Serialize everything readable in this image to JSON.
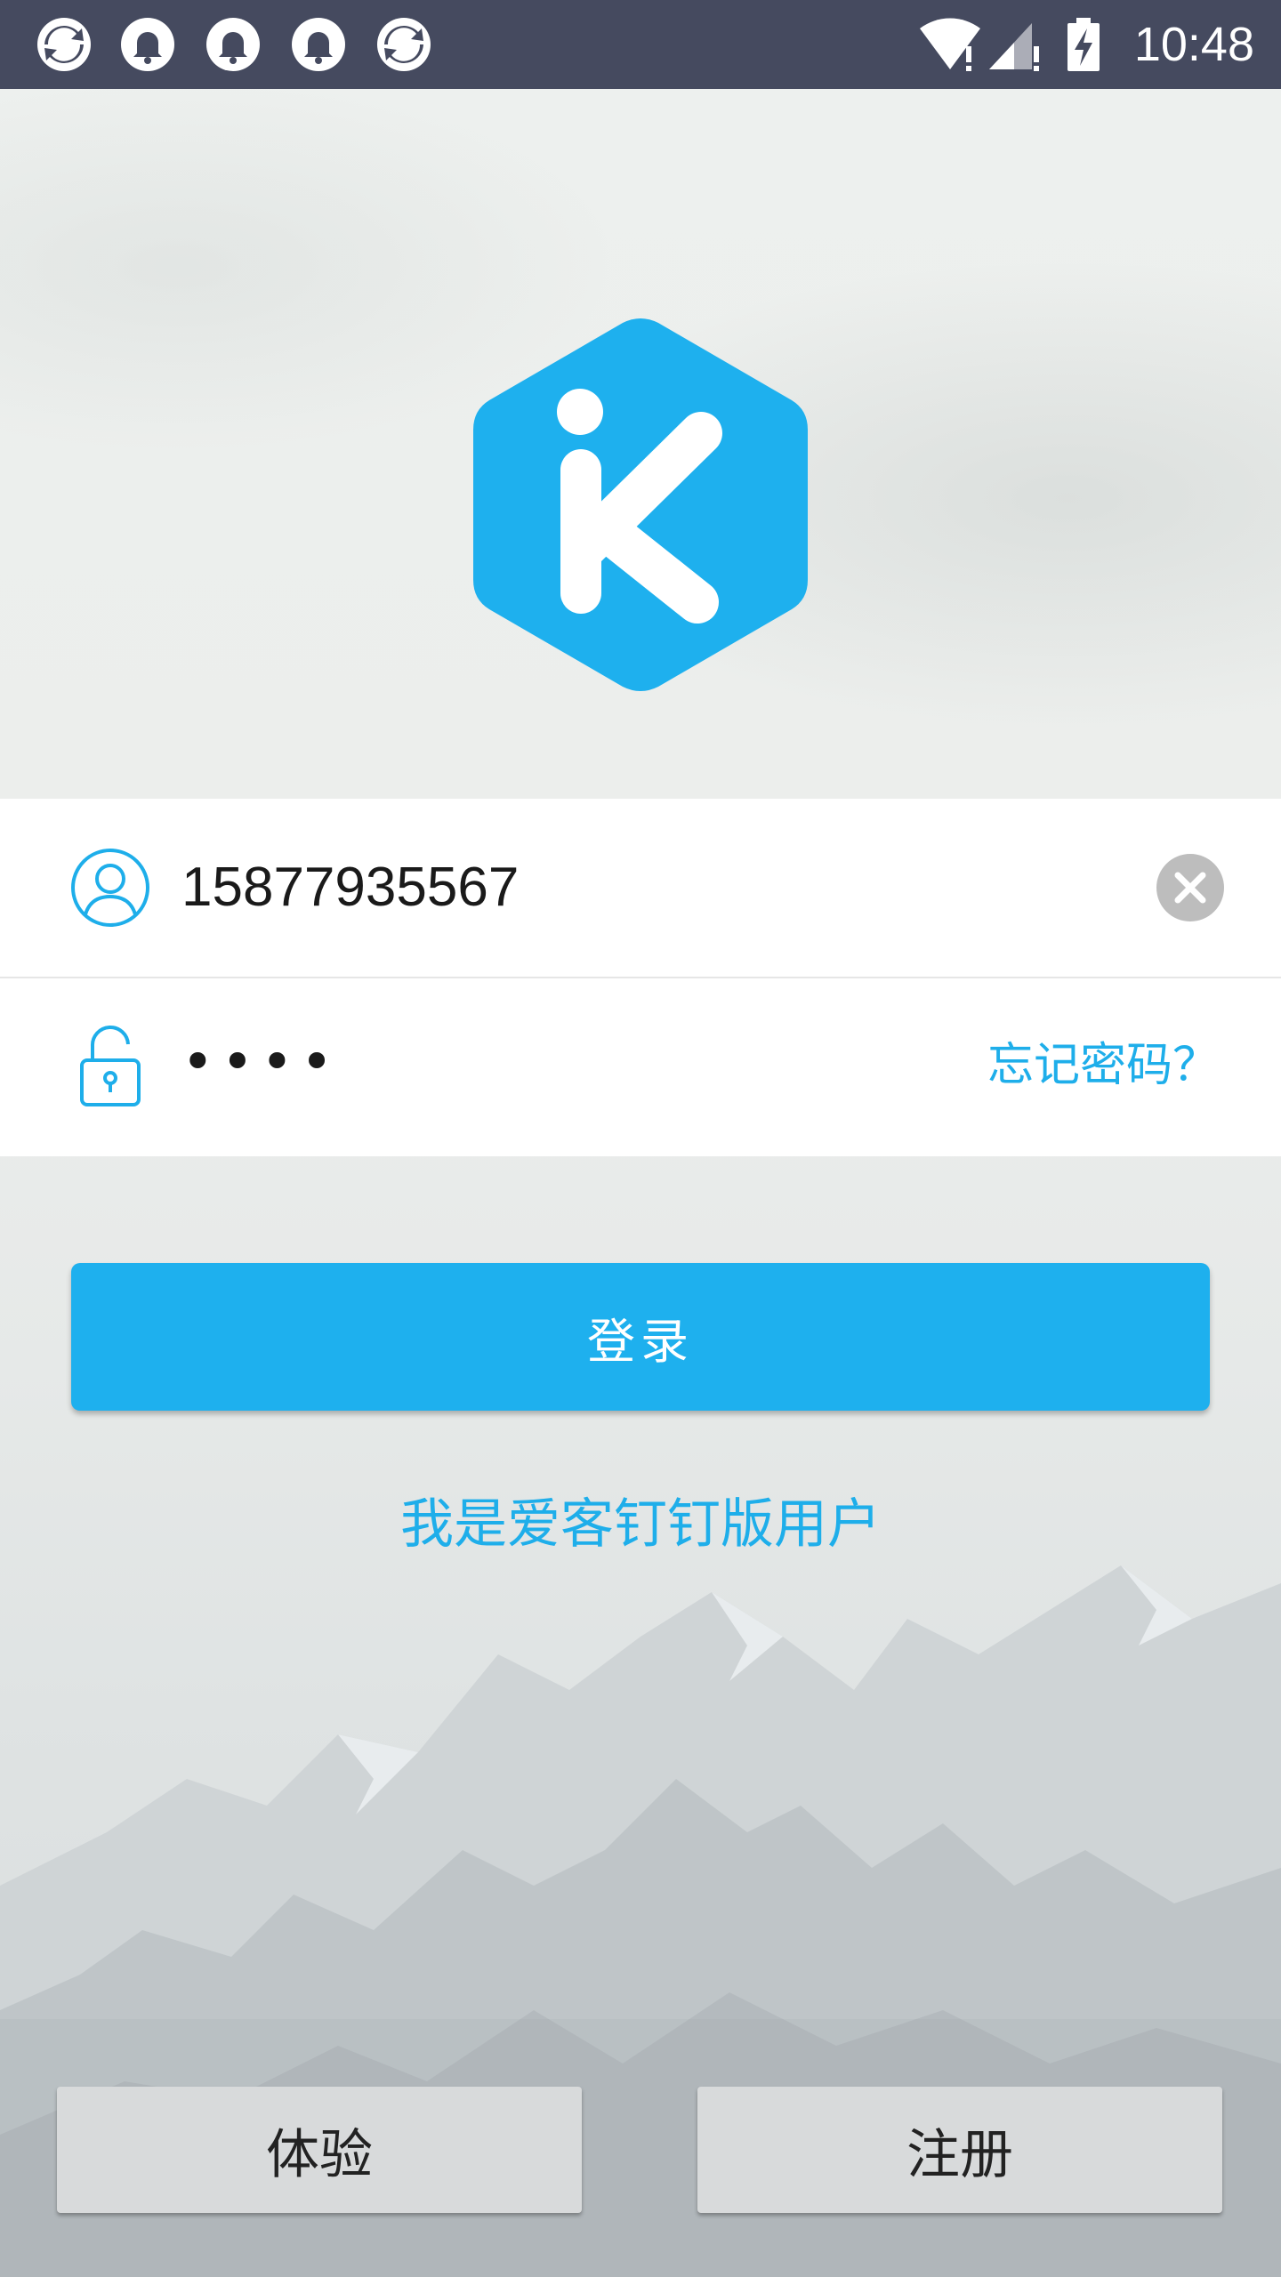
{
  "status_bar": {
    "time": "10:48",
    "left_icons": [
      "sync-icon",
      "bell-icon",
      "bell-icon",
      "bell-icon",
      "sync-icon"
    ],
    "right_icons": [
      "wifi-icon",
      "signal-icon",
      "battery-charging-icon"
    ]
  },
  "login": {
    "phone_value": "15877935567",
    "password_mask": "••••",
    "forgot_password": "忘记密码？",
    "login_button": "登录",
    "dingding_link": "我是爱客钉钉版用户"
  },
  "bottom": {
    "trial_button": "体验",
    "register_button": "注册"
  },
  "colors": {
    "accent": "#1eb0ee",
    "status_bar": "#454a5f",
    "button_grey": "#d8dadb"
  }
}
